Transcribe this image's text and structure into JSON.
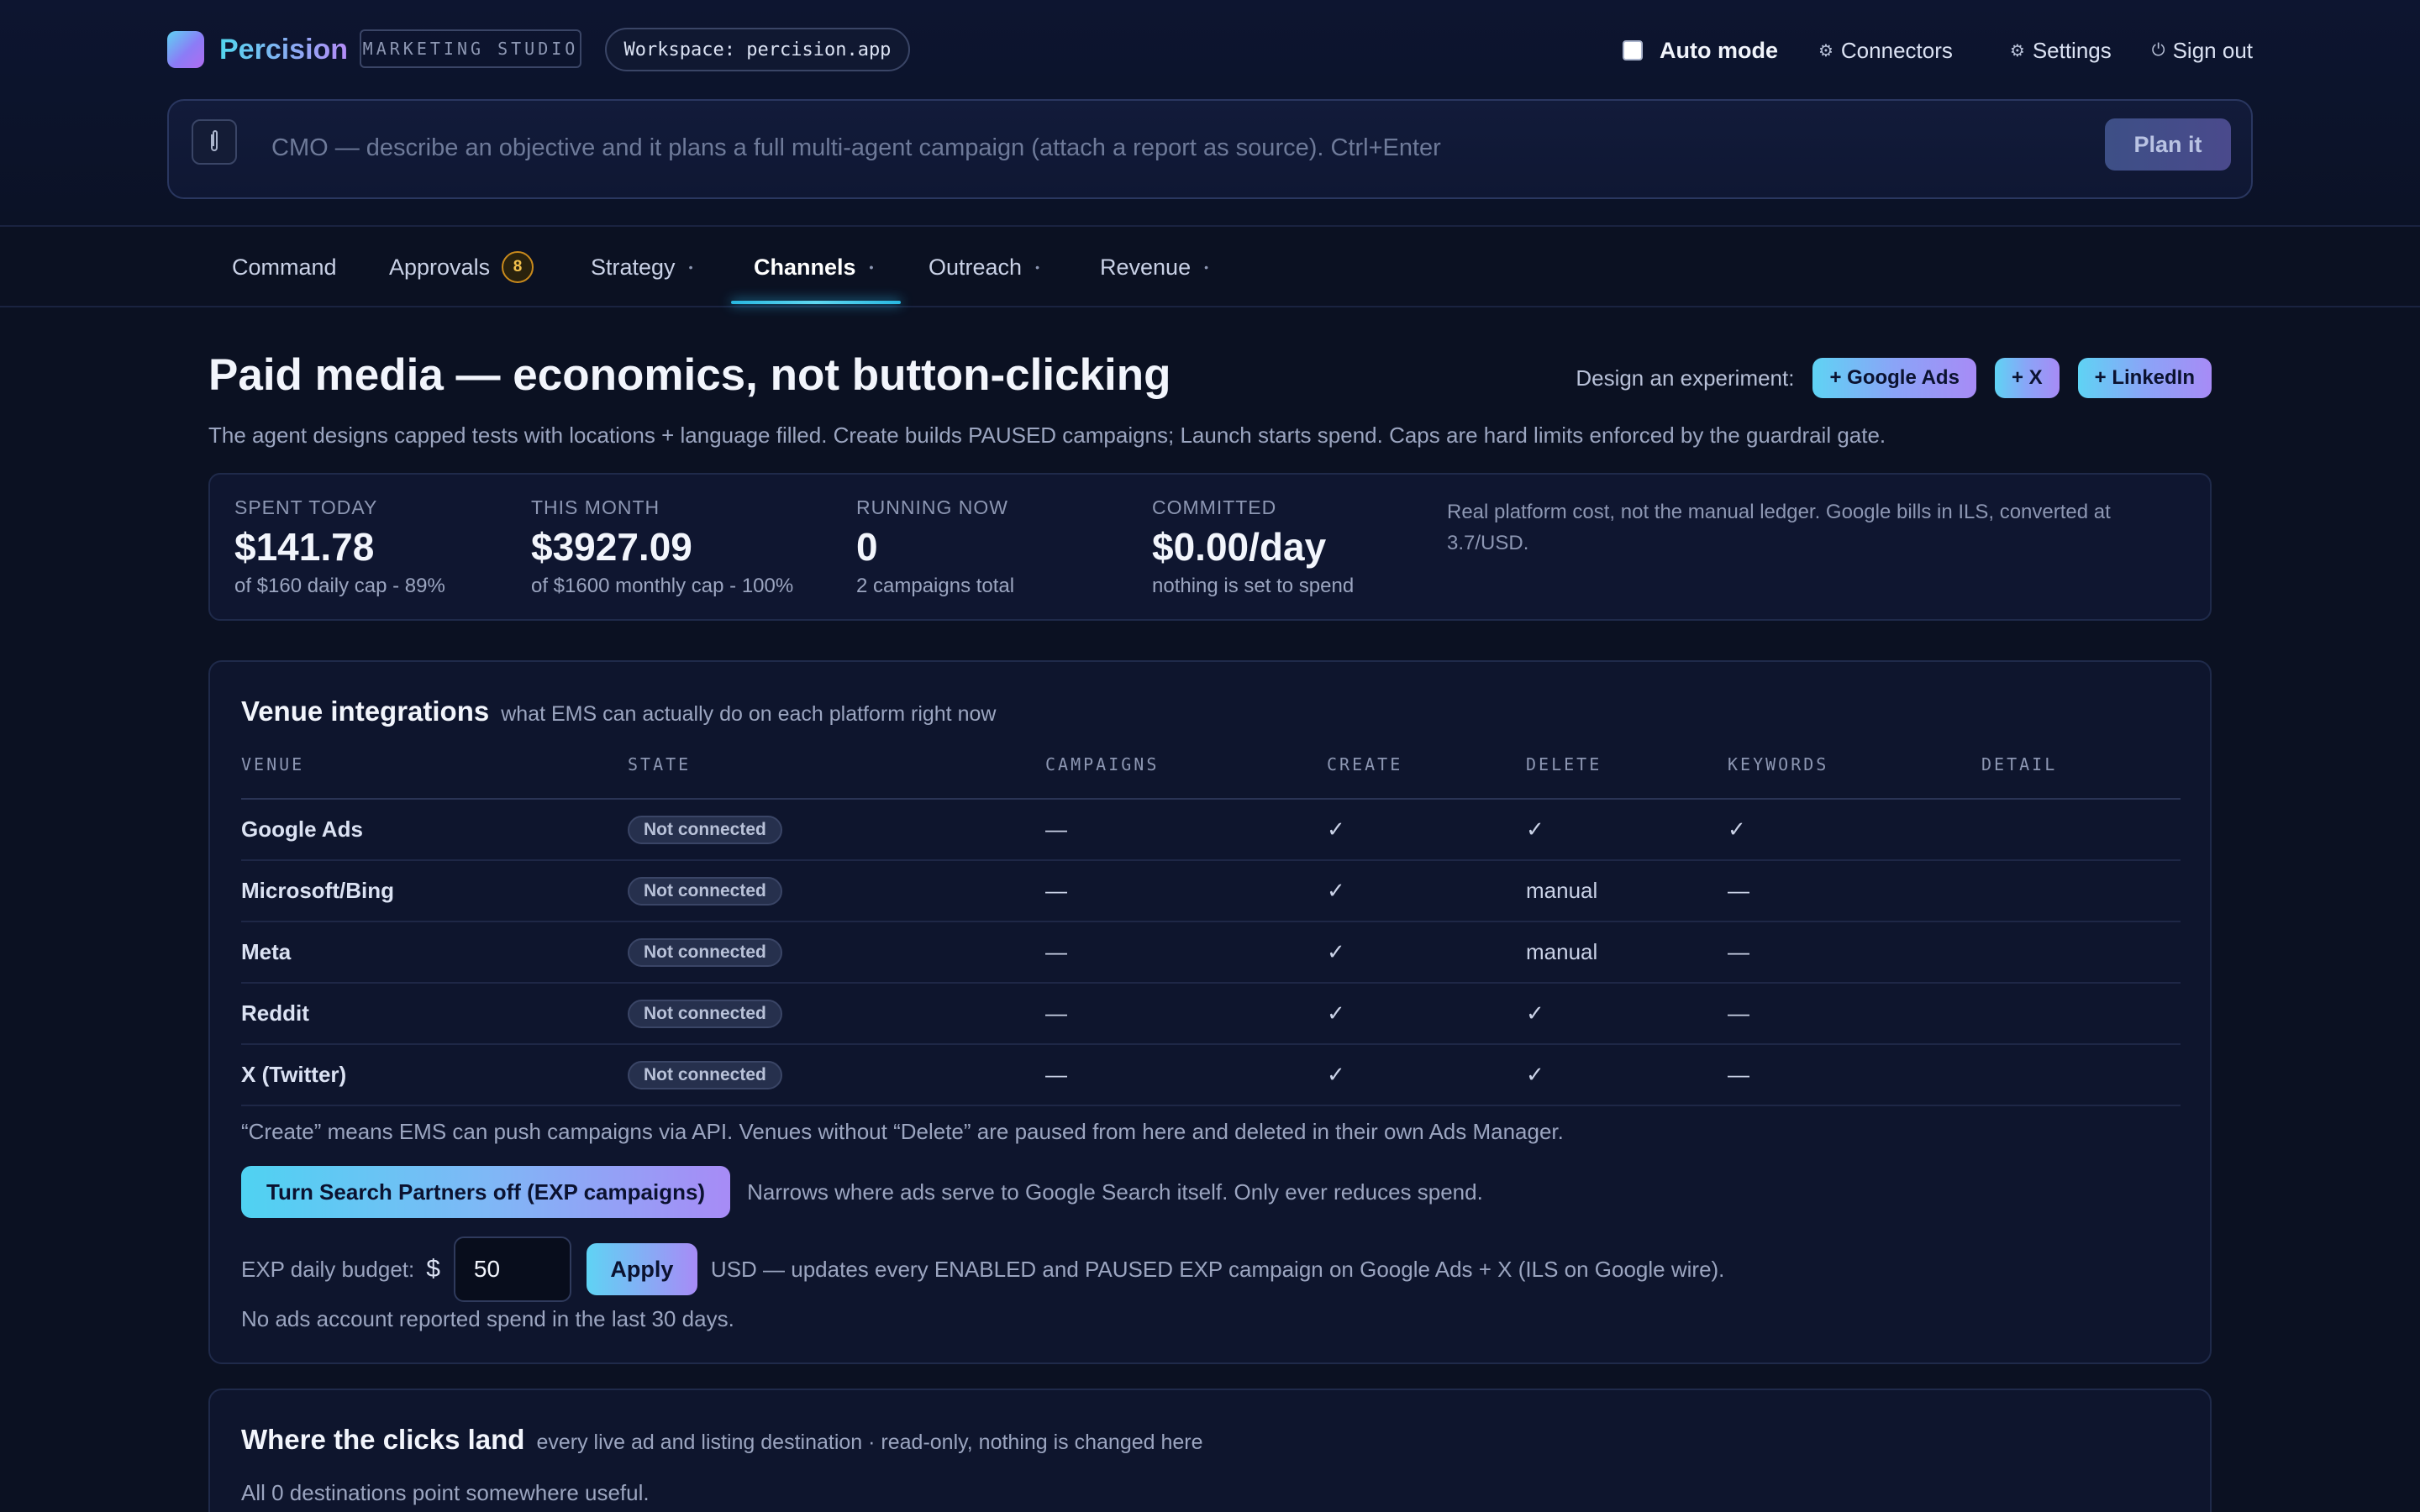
{
  "header": {
    "brand": "Percision",
    "studio_badge": "MARKETING STUDIO",
    "workspace": "Workspace: percision.app",
    "auto_mode_label": "Auto mode",
    "connectors_label": "Connectors",
    "settings_label": "Settings",
    "signout_label": "Sign out"
  },
  "command": {
    "placeholder": "CMO — describe an objective and it plans a full multi-agent campaign (attach a report as source). Ctrl+Enter",
    "plan_button": "Plan it"
  },
  "tabs": [
    {
      "label": "Command"
    },
    {
      "label": "Approvals",
      "badge": "8"
    },
    {
      "label": "Strategy",
      "dot": "•"
    },
    {
      "label": "Channels",
      "dot": "•",
      "active": true
    },
    {
      "label": "Outreach",
      "dot": "•"
    },
    {
      "label": "Revenue",
      "dot": "•"
    }
  ],
  "page": {
    "title": "Paid media — economics, not button-clicking",
    "subtitle": "The agent designs capped tests with locations + language filled. Create builds PAUSED campaigns; Launch starts spend. Caps are hard limits enforced by the guardrail gate.",
    "experiment_label": "Design an experiment:",
    "experiment_buttons": [
      "+ Google Ads",
      "+ X",
      "+ LinkedIn"
    ]
  },
  "stats": [
    {
      "label": "SPENT TODAY",
      "value": "$141.78",
      "note": "of $160 daily cap - 89%"
    },
    {
      "label": "THIS MONTH",
      "value": "$3927.09",
      "note": "of $1600 monthly cap - 100%"
    },
    {
      "label": "RUNNING NOW",
      "value": "0",
      "note": "2 campaigns total"
    },
    {
      "label": "COMMITTED",
      "value": "$0.00/day",
      "note": "nothing is set to spend"
    }
  ],
  "stats_note": "Real platform cost, not the manual ledger. Google bills in ILS, converted at 3.7/USD.",
  "venues": {
    "title": "Venue integrations",
    "subtitle": "what EMS can actually do on each platform right now",
    "columns": [
      "VENUE",
      "STATE",
      "CAMPAIGNS",
      "CREATE",
      "DELETE",
      "KEYWORDS",
      "DETAIL"
    ],
    "rows": [
      {
        "venue": "Google Ads",
        "state": "Not connected",
        "campaigns": "—",
        "create": "✓",
        "delete": "✓",
        "keywords": "✓",
        "detail": ""
      },
      {
        "venue": "Microsoft/Bing",
        "state": "Not connected",
        "campaigns": "—",
        "create": "✓",
        "delete": "manual",
        "keywords": "—",
        "detail": ""
      },
      {
        "venue": "Meta",
        "state": "Not connected",
        "campaigns": "—",
        "create": "✓",
        "delete": "manual",
        "keywords": "—",
        "detail": ""
      },
      {
        "venue": "Reddit",
        "state": "Not connected",
        "campaigns": "—",
        "create": "✓",
        "delete": "✓",
        "keywords": "—",
        "detail": ""
      },
      {
        "venue": "X (Twitter)",
        "state": "Not connected",
        "campaigns": "—",
        "create": "✓",
        "delete": "✓",
        "keywords": "—",
        "detail": ""
      }
    ],
    "footnote": "“Create” means EMS can push campaigns via API. Venues without “Delete” are paused from here and deleted in their own Ads Manager.",
    "search_partners_button": "Turn Search Partners off (EXP campaigns)",
    "search_partners_desc": "Narrows where ads serve to Google Search itself. Only ever reduces spend.",
    "budget_label": "EXP daily budget:",
    "budget_currency": "$",
    "budget_value": "50",
    "apply_button": "Apply",
    "budget_desc": "USD — updates every ENABLED and PAUSED EXP campaign on Google Ads + X (ILS on Google wire).",
    "spend_note": "No ads account reported spend in the last 30 days."
  },
  "clicks": {
    "title": "Where the clicks land",
    "subtitle": "every live ad and listing destination · read-only, nothing is changed here",
    "note": "All 0 destinations point somewhere useful."
  },
  "colors": {
    "background": "#0b1122",
    "accent_cyan": "#5fd3f4",
    "accent_violet": "#a78bf6",
    "badge_amber": "#f4c24d"
  },
  "icons": {
    "connectors": "gear-icon",
    "settings": "gear-icon",
    "signout": "power-icon",
    "attach": "paperclip-icon"
  }
}
